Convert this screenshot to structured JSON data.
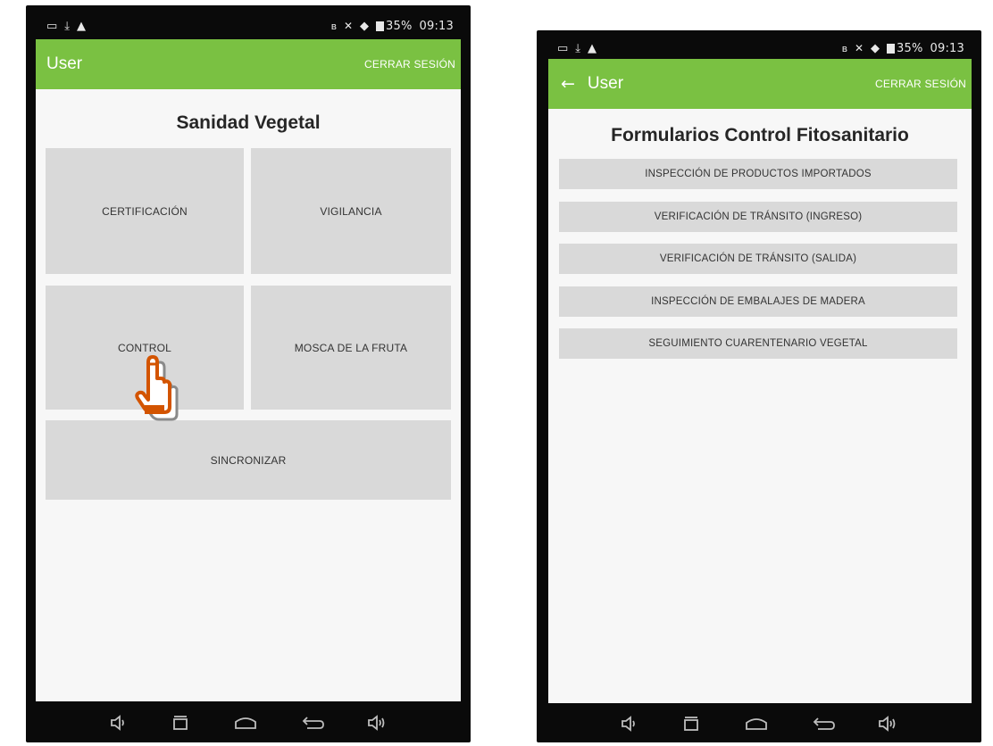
{
  "status_bar": {
    "left_icons": [
      "screenshot-icon",
      "download-icon",
      "warning-icon"
    ],
    "right_icons": [
      "bluetooth-icon",
      "mute-icon",
      "wifi-icon",
      "battery-icon"
    ],
    "battery_text": "35%",
    "time": "09:13"
  },
  "left_screen": {
    "appbar": {
      "title": "User",
      "logout": "CERRAR SESIÓN"
    },
    "heading": "Sanidad Vegetal",
    "tiles": {
      "certificacion": "CERTIFICACIÓN",
      "vigilancia": "VIGILANCIA",
      "control": "CONTROL",
      "mosca": "MOSCA DE LA FRUTA",
      "sincronizar": "SINCRONIZAR"
    }
  },
  "right_screen": {
    "appbar": {
      "back": "←",
      "title": "User",
      "logout": "CERRAR SESIÓN"
    },
    "heading": "Formularios Control Fitosanitario",
    "forms": [
      "INSPECCIÓN DE PRODUCTOS IMPORTADOS",
      "VERIFICACIÓN DE TRÁNSITO (INGRESO)",
      "VERIFICACIÓN DE TRÁNSITO (SALIDA)",
      "INSPECCIÓN DE EMBALAJES DE MADERA",
      "SEGUIMIENTO CUARENTENARIO VEGETAL"
    ]
  },
  "nav_icons": [
    "volume-down-icon",
    "recent-apps-icon",
    "home-icon",
    "back-icon",
    "volume-up-icon"
  ],
  "colors": {
    "accent": "#7ac142",
    "button": "#d9d9d9",
    "pointer": "#d35400"
  }
}
